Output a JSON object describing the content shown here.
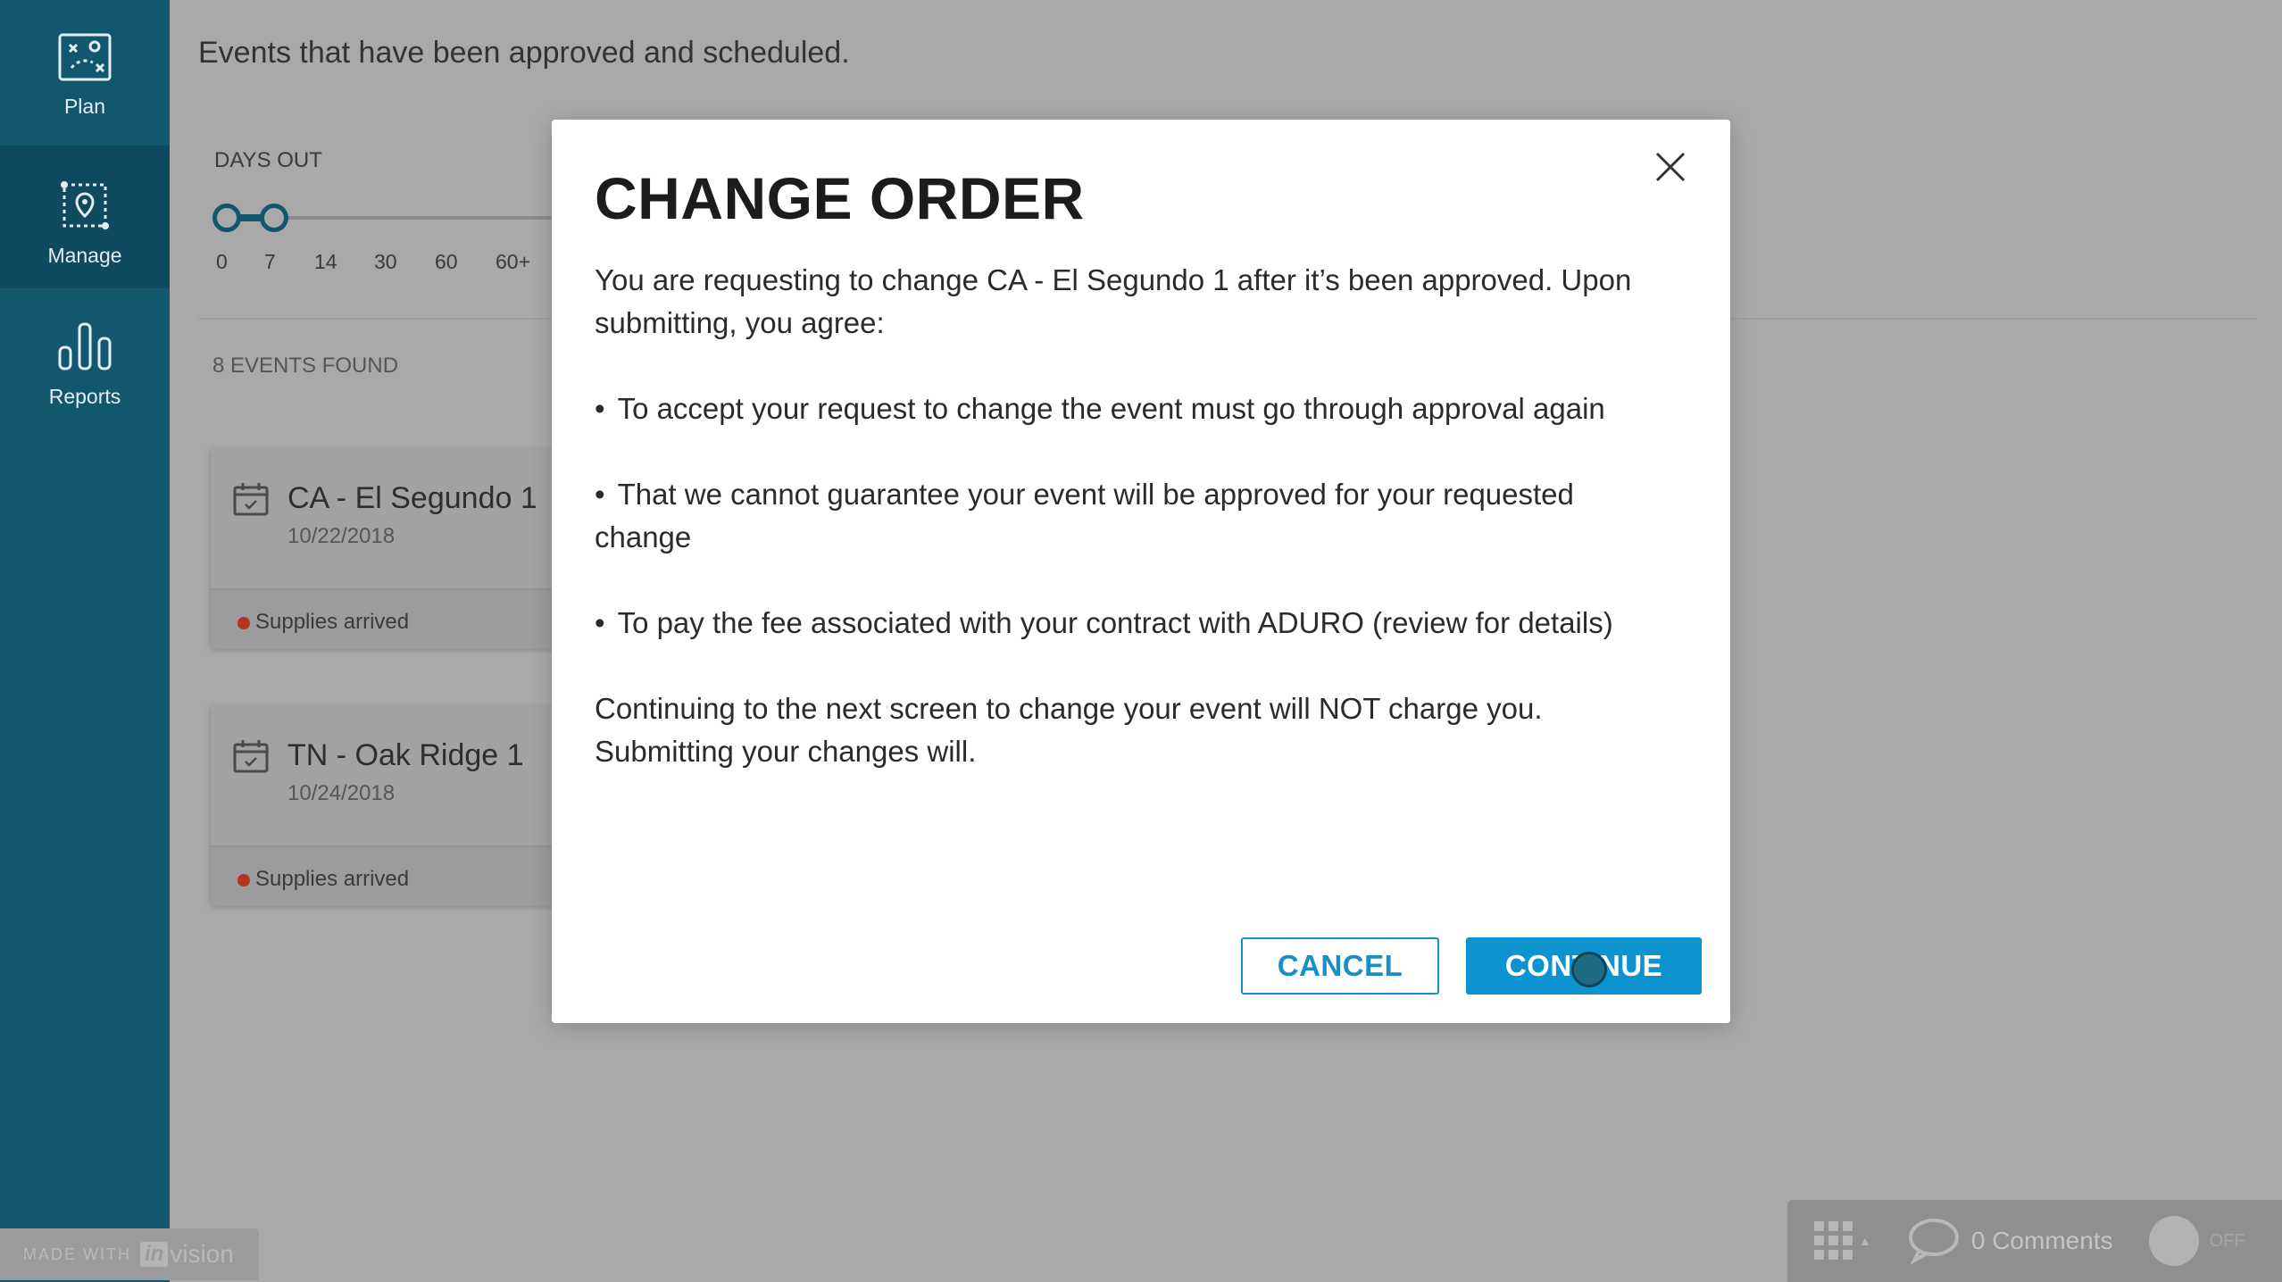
{
  "sidebar": {
    "items": [
      {
        "label": "Plan",
        "icon": "plan-map-icon"
      },
      {
        "label": "Manage",
        "icon": "manage-location-icon",
        "active": true
      },
      {
        "label": "Reports",
        "icon": "bar-chart-icon"
      }
    ],
    "badge": {
      "made_with": "MADE WITH",
      "in": "in",
      "vision": "vision"
    }
  },
  "main": {
    "subtitle": "Events that have been approved and scheduled.",
    "days_out": {
      "label": "DAYS OUT",
      "ticks": [
        "0",
        "7",
        "14",
        "30",
        "60",
        "60+"
      ],
      "selected_range": [
        "0",
        "7"
      ]
    },
    "events_found": "8 EVENTS FOUND",
    "events": [
      {
        "title": "CA - El Segundo 1",
        "date": "10/22/2018",
        "status": "Supplies arrived"
      },
      {
        "title": "TN - Oak Ridge 1",
        "date": "10/24/2018",
        "status": "Supplies arrived"
      }
    ]
  },
  "modal": {
    "title": "CHANGE ORDER",
    "intro": "You are requesting to change CA - El Segundo 1 after it’s been approved. Upon submitting, you agree:",
    "bullets": [
      "To accept your request to change the event must go through approval again",
      "That we cannot guarantee your event will be approved for your requested change",
      "To pay the fee associated with your contract with ADURO (review for details)"
    ],
    "bullet_char": "•",
    "note": "Continuing to the next screen to change your event will NOT charge you. Submitting your changes will.",
    "cancel_label": "CANCEL",
    "continue_label": "CONTINUE"
  },
  "bottom_bar": {
    "comments": "0 Comments",
    "toggle": "OFF"
  },
  "colors": {
    "sidebar": "#12576d",
    "accent": "#0d93cf",
    "status_dot": "#b8331f"
  }
}
